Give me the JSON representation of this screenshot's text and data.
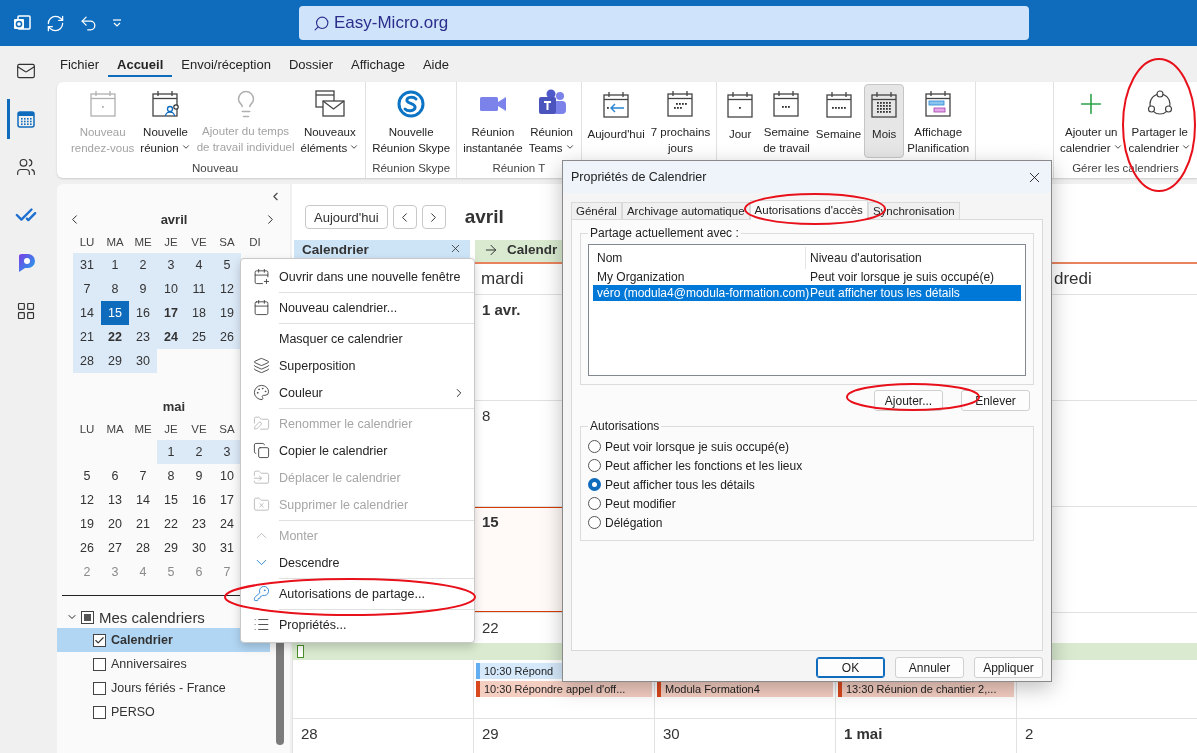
{
  "title_bar": {
    "icons": [
      {
        "kind": "app"
      },
      {
        "kind": "sync"
      },
      {
        "kind": "undo"
      },
      {
        "kind": "customize"
      }
    ],
    "search": "Easy-Micro.org"
  },
  "rail": [
    {
      "kind": "mail",
      "selected": false
    },
    {
      "kind": "calendar",
      "selected": true
    },
    {
      "kind": "people",
      "selected": false
    },
    {
      "kind": "todo",
      "selected": false
    },
    {
      "kind": "copilot",
      "selected": false
    },
    {
      "kind": "apps",
      "selected": false
    }
  ],
  "menu_tabs": [
    {
      "label": "Fichier",
      "selected": false
    },
    {
      "label": "Accueil",
      "selected": true
    },
    {
      "label": "Envoi/réception",
      "selected": false
    },
    {
      "label": "Dossier",
      "selected": false
    },
    {
      "label": "Affichage",
      "selected": false
    },
    {
      "label": "Aide",
      "selected": false
    }
  ],
  "ribbon": {
    "groups": [
      {
        "label": "Nouveau",
        "buttons": [
          {
            "kind": "calendar-dot",
            "label": "Nouveau\nrendez-vous",
            "disabled": true,
            "dropdown": false,
            "selected": false
          },
          {
            "kind": "calendar-people",
            "label": "Nouvelle\nréunion",
            "disabled": false,
            "dropdown": true,
            "selected": false
          },
          {
            "kind": "lightbulb",
            "label": "Ajouter du temps\nde travail individuel",
            "disabled": true,
            "dropdown": false,
            "selected": false
          },
          {
            "kind": "calendar-envelope",
            "label": "Nouveaux\néléments",
            "disabled": false,
            "dropdown": true,
            "selected": false
          }
        ]
      },
      {
        "label": "Réunion Skype",
        "buttons": [
          {
            "kind": "skype",
            "label": "Nouvelle\nRéunion Skype",
            "disabled": false,
            "dropdown": false,
            "selected": false
          }
        ]
      },
      {
        "label": "Réunion T",
        "buttons": [
          {
            "kind": "video",
            "label": "Réunion\ninstantanée",
            "disabled": false,
            "dropdown": false,
            "selected": false
          },
          {
            "kind": "teams",
            "label": "Réunion\nTeams",
            "disabled": false,
            "dropdown": true,
            "selected": false
          }
        ]
      },
      {
        "buttons": [
          {
            "kind": "today",
            "label": "Aujourd'hui",
            "disabled": false,
            "dropdown": false,
            "selected": false
          },
          {
            "kind": "next7",
            "label": "7 prochains\njours",
            "disabled": false,
            "dropdown": false,
            "selected": false
          }
        ]
      },
      {
        "buttons": [
          {
            "kind": "day",
            "label": "Jour",
            "disabled": false,
            "dropdown": false,
            "selected": false
          },
          {
            "kind": "workweek",
            "label": "Semaine\nde travail",
            "disabled": false,
            "dropdown": false,
            "selected": false
          },
          {
            "kind": "week",
            "label": "Semaine",
            "disabled": false,
            "dropdown": false,
            "selected": false
          },
          {
            "kind": "month",
            "label": "Mois",
            "disabled": false,
            "dropdown": false,
            "selected": true
          },
          {
            "kind": "schedule",
            "label": "Affichage\nPlanification",
            "disabled": false,
            "dropdown": false,
            "selected": false
          }
        ]
      },
      {
        "label": "Gérer les calendriers",
        "buttons": [
          {
            "kind": "plus",
            "label": "Ajouter un\ncalendrier",
            "disabled": false,
            "dropdown": true,
            "selected": false
          },
          {
            "kind": "share",
            "label": "Partager le\ncalendrier",
            "disabled": false,
            "dropdown": true,
            "selected": false
          }
        ]
      }
    ]
  },
  "navigation_pane": {
    "mini_calendars": [
      {
        "title": "avril",
        "nav": true,
        "weekdays": [
          "LU",
          "MA",
          "ME",
          "JE",
          "VE",
          "SA",
          "DI"
        ],
        "weeks": [
          [
            {
              "kind": "day",
              "text": "31",
              "highlighted": true,
              "selected": false,
              "bold": false,
              "muted": false
            },
            {
              "kind": "day",
              "text": "1",
              "highlighted": true,
              "selected": false,
              "bold": false,
              "muted": false
            },
            {
              "kind": "day",
              "text": "2",
              "highlighted": true,
              "selected": false,
              "bold": false,
              "muted": false
            },
            {
              "kind": "day",
              "text": "3",
              "highlighted": true,
              "selected": false,
              "bold": false,
              "muted": false
            },
            {
              "kind": "day",
              "text": "4",
              "highlighted": true,
              "selected": false,
              "bold": false,
              "muted": false
            },
            {
              "kind": "day",
              "text": "5",
              "highlighted": true,
              "selected": false,
              "bold": false,
              "muted": false
            }
          ],
          [
            {
              "kind": "day",
              "text": "7",
              "highlighted": true,
              "selected": false,
              "bold": false,
              "muted": false
            },
            {
              "kind": "day",
              "text": "8",
              "highlighted": true,
              "selected": false,
              "bold": false,
              "muted": false
            },
            {
              "kind": "day",
              "text": "9",
              "highlighted": true,
              "selected": false,
              "bold": false,
              "muted": false
            },
            {
              "kind": "day",
              "text": "10",
              "highlighted": true,
              "selected": false,
              "bold": false,
              "muted": false
            },
            {
              "kind": "day",
              "text": "11",
              "highlighted": true,
              "selected": false,
              "bold": false,
              "muted": false
            },
            {
              "kind": "day",
              "text": "12",
              "highlighted": true,
              "selected": false,
              "bold": false,
              "muted": false
            }
          ],
          [
            {
              "kind": "day",
              "text": "14",
              "highlighted": true,
              "selected": false,
              "bold": false,
              "muted": false
            },
            {
              "kind": "day",
              "text": "15",
              "highlighted": true,
              "selected": true,
              "bold": false,
              "muted": false
            },
            {
              "kind": "day",
              "text": "16",
              "highlighted": true,
              "selected": false,
              "bold": false,
              "muted": false
            },
            {
              "kind": "day",
              "text": "17",
              "highlighted": true,
              "selected": false,
              "bold": true,
              "muted": false
            },
            {
              "kind": "day",
              "text": "18",
              "highlighted": true,
              "selected": false,
              "bold": false,
              "muted": false
            },
            {
              "kind": "day",
              "text": "19",
              "highlighted": true,
              "selected": false,
              "bold": false,
              "muted": false
            }
          ],
          [
            {
              "kind": "day",
              "text": "21",
              "highlighted": true,
              "selected": false,
              "bold": false,
              "muted": false
            },
            {
              "kind": "day",
              "text": "22",
              "highlighted": true,
              "selected": false,
              "bold": true,
              "muted": false
            },
            {
              "kind": "day",
              "text": "23",
              "highlighted": true,
              "selected": false,
              "bold": false,
              "muted": false
            },
            {
              "kind": "day",
              "text": "24",
              "highlighted": true,
              "selected": false,
              "bold": true,
              "muted": false
            },
            {
              "kind": "day",
              "text": "25",
              "highlighted": true,
              "selected": false,
              "bold": false,
              "muted": false
            },
            {
              "kind": "day",
              "text": "26",
              "highlighted": true,
              "selected": false,
              "bold": false,
              "muted": false
            }
          ],
          [
            {
              "kind": "day",
              "text": "28",
              "highlighted": true,
              "selected": false,
              "bold": false,
              "muted": false
            },
            {
              "kind": "day",
              "text": "29",
              "highlighted": true,
              "selected": false,
              "bold": false,
              "muted": false
            },
            {
              "kind": "day",
              "text": "30",
              "highlighted": true,
              "selected": false,
              "bold": false,
              "muted": false
            }
          ]
        ]
      },
      {
        "title": "mai",
        "nav": false,
        "weekdays": [
          "LU",
          "MA",
          "ME",
          "JE",
          "VE",
          "SA"
        ],
        "weeks": [
          [
            {
              "kind": "blank"
            },
            {
              "kind": "blank"
            },
            {
              "kind": "blank"
            },
            {
              "kind": "day",
              "text": "1",
              "highlighted": true,
              "selected": false,
              "bold": false,
              "muted": false
            },
            {
              "kind": "day",
              "text": "2",
              "highlighted": true,
              "selected": false,
              "bold": false,
              "muted": false
            },
            {
              "kind": "day",
              "text": "3",
              "highlighted": true,
              "selected": false,
              "bold": false,
              "muted": false
            }
          ],
          [
            {
              "kind": "day",
              "text": "5",
              "highlighted": false,
              "selected": false,
              "bold": false,
              "muted": false
            },
            {
              "kind": "day",
              "text": "6",
              "highlighted": false,
              "selected": false,
              "bold": false,
              "muted": false
            },
            {
              "kind": "day",
              "text": "7",
              "highlighted": false,
              "selected": false,
              "bold": false,
              "muted": false
            },
            {
              "kind": "day",
              "text": "8",
              "highlighted": false,
              "selected": false,
              "bold": false,
              "muted": false
            },
            {
              "kind": "day",
              "text": "9",
              "highlighted": false,
              "selected": false,
              "bold": false,
              "muted": false
            },
            {
              "kind": "day",
              "text": "10",
              "highlighted": false,
              "selected": false,
              "bold": false,
              "muted": false
            }
          ],
          [
            {
              "kind": "day",
              "text": "12",
              "highlighted": false,
              "selected": false,
              "bold": false,
              "muted": false
            },
            {
              "kind": "day",
              "text": "13",
              "highlighted": false,
              "selected": false,
              "bold": false,
              "muted": false
            },
            {
              "kind": "day",
              "text": "14",
              "highlighted": false,
              "selected": false,
              "bold": false,
              "muted": false
            },
            {
              "kind": "day",
              "text": "15",
              "highlighted": false,
              "selected": false,
              "bold": false,
              "muted": false
            },
            {
              "kind": "day",
              "text": "16",
              "highlighted": false,
              "selected": false,
              "bold": false,
              "muted": false
            },
            {
              "kind": "day",
              "text": "17",
              "highlighted": false,
              "selected": false,
              "bold": false,
              "muted": false
            }
          ],
          [
            {
              "kind": "day",
              "text": "19",
              "highlighted": false,
              "selected": false,
              "bold": false,
              "muted": false
            },
            {
              "kind": "day",
              "text": "20",
              "highlighted": false,
              "selected": false,
              "bold": false,
              "muted": false
            },
            {
              "kind": "day",
              "text": "21",
              "highlighted": false,
              "selected": false,
              "bold": false,
              "muted": false
            },
            {
              "kind": "day",
              "text": "22",
              "highlighted": false,
              "selected": false,
              "bold": false,
              "muted": false
            },
            {
              "kind": "day",
              "text": "23",
              "highlighted": false,
              "selected": false,
              "bold": false,
              "muted": false
            },
            {
              "kind": "day",
              "text": "24",
              "highlighted": false,
              "selected": false,
              "bold": false,
              "muted": false
            }
          ],
          [
            {
              "kind": "day",
              "text": "26",
              "highlighted": false,
              "selected": false,
              "bold": false,
              "muted": false
            },
            {
              "kind": "day",
              "text": "27",
              "highlighted": false,
              "selected": false,
              "bold": false,
              "muted": false
            },
            {
              "kind": "day",
              "text": "28",
              "highlighted": false,
              "selected": false,
              "bold": false,
              "muted": false
            },
            {
              "kind": "day",
              "text": "29",
              "highlighted": false,
              "selected": false,
              "bold": false,
              "muted": false
            },
            {
              "kind": "day",
              "text": "30",
              "highlighted": false,
              "selected": false,
              "bold": false,
              "muted": false
            },
            {
              "kind": "day",
              "text": "31",
              "highlighted": false,
              "selected": false,
              "bold": false,
              "muted": false
            }
          ],
          [
            {
              "kind": "day",
              "text": "2",
              "highlighted": false,
              "selected": false,
              "bold": false,
              "muted": true
            },
            {
              "kind": "day",
              "text": "3",
              "highlighted": false,
              "selected": false,
              "bold": false,
              "muted": true
            },
            {
              "kind": "day",
              "text": "4",
              "highlighted": false,
              "selected": false,
              "bold": false,
              "muted": true
            },
            {
              "kind": "day",
              "text": "5",
              "highlighted": false,
              "selected": false,
              "bold": false,
              "muted": true
            },
            {
              "kind": "day",
              "text": "6",
              "highlighted": false,
              "selected": false,
              "bold": false,
              "muted": true
            },
            {
              "kind": "day",
              "text": "7",
              "highlighted": false,
              "selected": false,
              "bold": false,
              "muted": true
            }
          ]
        ]
      }
    ],
    "folders": {
      "label": "Mes calendriers",
      "expanded": true,
      "checked": true,
      "items": [
        {
          "label": "Calendrier",
          "checked": true,
          "selected": true
        },
        {
          "label": "Anniversaires",
          "checked": false,
          "selected": false
        },
        {
          "label": "Jours fériés - France",
          "checked": false,
          "selected": false
        },
        {
          "label": "PERSO",
          "checked": false,
          "selected": false
        }
      ]
    }
  },
  "calendar": {
    "today_button": "Aujourd'hui",
    "title": "avril",
    "tabs": [
      {
        "kind": "close",
        "label": "Calendrier",
        "color": "#cde3f6"
      },
      {
        "kind": "arrow",
        "label": "Calendr",
        "color": "#d9ead0"
      }
    ],
    "day_names": [
      {
        "kind": "blank"
      },
      {
        "kind": "name",
        "text": "mardi"
      },
      {
        "kind": "blank"
      },
      {
        "kind": "blank"
      },
      {
        "kind": "name",
        "text": "dredi"
      }
    ],
    "weeks": [
      {
        "cells": [
          {
            "kind": "blank"
          },
          {
            "kind": "day",
            "text": "1 avr.",
            "bold": true,
            "today": false
          },
          {
            "kind": "blank"
          },
          {
            "kind": "blank"
          },
          {
            "kind": "blank"
          }
        ]
      },
      {
        "cells": [
          {
            "kind": "blank"
          },
          {
            "kind": "day",
            "text": "8",
            "bold": false,
            "today": false
          },
          {
            "kind": "blank"
          },
          {
            "kind": "blank"
          },
          {
            "kind": "blank"
          }
        ]
      },
      {
        "cells": [
          {
            "kind": "blank"
          },
          {
            "kind": "day",
            "text": "15",
            "bold": true,
            "today": true
          },
          {
            "kind": "blank"
          },
          {
            "kind": "blank"
          },
          {
            "kind": "blank"
          }
        ]
      },
      {
        "all_day_event": {
          "color": "#d9ead0"
        },
        "cells": [
          {
            "kind": "blank"
          },
          {
            "kind": "day",
            "text": "22",
            "bold": false,
            "today": false,
            "events": [
              {
                "kind": "event",
                "text": "10:30 Répond",
                "color": "#62aef0"
              },
              {
                "kind": "event",
                "text": "10:30 Répondre appel d'off...",
                "color": "#d9481c"
              }
            ]
          },
          {
            "kind": "blank",
            "events": [
              {
                "kind": "blank"
              },
              {
                "kind": "event",
                "text": "Modula Formation4",
                "color": "#d9481c"
              }
            ]
          },
          {
            "kind": "blank",
            "events": [
              {
                "kind": "blank"
              },
              {
                "kind": "event",
                "text": "13:30 Réunion de chantier 2,...",
                "color": "#d9481c"
              }
            ]
          },
          {
            "kind": "blank"
          }
        ]
      },
      {
        "cells": [
          {
            "kind": "day",
            "text": "28",
            "bold": false,
            "today": false
          },
          {
            "kind": "day",
            "text": "29",
            "bold": false,
            "today": false
          },
          {
            "kind": "day",
            "text": "30",
            "bold": false,
            "today": false
          },
          {
            "kind": "day",
            "text": "1 mai",
            "bold": true,
            "today": false
          },
          {
            "kind": "day",
            "text": "2",
            "bold": false,
            "today": false
          }
        ]
      }
    ]
  },
  "context_menu": {
    "groups": [
      [
        {
          "kind": "calendar-plus",
          "label": "Ouvrir dans une nouvelle fenêtre",
          "disabled": false,
          "submenu": false
        }
      ],
      [
        {
          "kind": "calendar",
          "label": "Nouveau calendrier...",
          "disabled": false,
          "submenu": false
        }
      ],
      [
        {
          "kind": "none",
          "label": "Masquer ce calendrier",
          "disabled": false,
          "submenu": false
        },
        {
          "kind": "layers",
          "label": "Superposition",
          "disabled": false,
          "submenu": false
        },
        {
          "kind": "palette",
          "label": "Couleur",
          "disabled": false,
          "submenu": true
        }
      ],
      [
        {
          "kind": "folder-pen",
          "label": "Renommer le calendrier",
          "disabled": true,
          "submenu": false
        },
        {
          "kind": "copy",
          "label": "Copier le calendrier",
          "disabled": false,
          "submenu": false
        },
        {
          "kind": "folder-input",
          "label": "Déplacer le calendrier",
          "disabled": true,
          "submenu": false
        },
        {
          "kind": "folder-x",
          "label": "Supprimer le calendrier",
          "disabled": true,
          "submenu": false
        }
      ],
      [
        {
          "kind": "chevron-up",
          "label": "Monter",
          "disabled": true,
          "submenu": false
        },
        {
          "kind": "chevron-down",
          "label": "Descendre",
          "disabled": false,
          "submenu": false
        }
      ],
      [
        {
          "kind": "key",
          "label": "Autorisations de partage...",
          "disabled": false,
          "submenu": false
        }
      ],
      [
        {
          "kind": "list",
          "label": "Propriétés...",
          "disabled": false,
          "submenu": false
        }
      ]
    ]
  },
  "dialog": {
    "title": "Propriétés de Calendrier",
    "tabs": [
      {
        "label": "Général",
        "selected": false
      },
      {
        "label": "Archivage automatique",
        "selected": false
      },
      {
        "label": "Autorisations d'accès",
        "selected": true
      },
      {
        "label": "Synchronisation",
        "selected": false
      }
    ],
    "sharing": {
      "legend": "Partage actuellement avec :",
      "columns": [
        "Nom",
        "Niveau d'autorisation"
      ],
      "rows": [
        {
          "cells": [
            "My Organization",
            "Peut voir lorsque je suis occupé(e)"
          ],
          "selected": false
        },
        {
          "cells": [
            "véro (modula4@modula-formation.com)",
            "Peut afficher tous les détails"
          ],
          "selected": true
        }
      ],
      "buttons": [
        "Ajouter...",
        "Enlever"
      ]
    },
    "permissions": {
      "legend": "Autorisations",
      "options": [
        {
          "label": "Peut voir lorsque je suis occupé(e)",
          "selected": false
        },
        {
          "label": "Peut afficher les fonctions et les lieux",
          "selected": false
        },
        {
          "label": "Peut afficher tous les détails",
          "selected": true
        },
        {
          "label": "Peut modifier",
          "selected": false
        },
        {
          "label": "Délégation",
          "selected": false
        }
      ]
    },
    "footer": [
      {
        "label": "OK",
        "default": true
      },
      {
        "label": "Annuler",
        "default": false
      },
      {
        "label": "Appliquer",
        "default": false
      }
    ]
  }
}
